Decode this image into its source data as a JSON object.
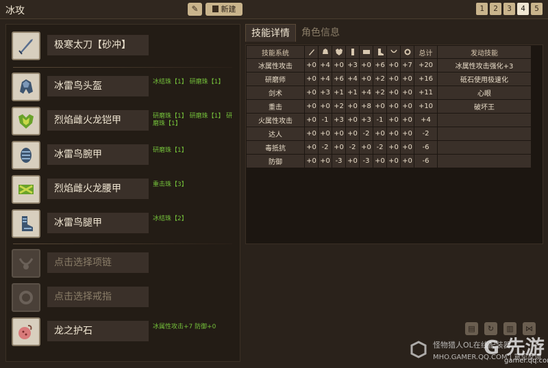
{
  "header": {
    "title": "冰攻",
    "edit_icon": "pencil-icon",
    "new_label": "新建",
    "pages": [
      "1",
      "2",
      "3",
      "4",
      "5"
    ],
    "active_page": "4"
  },
  "weapon": {
    "name": "极寒太刀【砂冲】",
    "icon": "sword-icon"
  },
  "armor": [
    {
      "name": "冰雷鸟头盔",
      "decorations": "冰结珠【1】  研磨珠【1】",
      "icon": "helmet-icon"
    },
    {
      "name": "烈焰雌火龙铠甲",
      "decorations": "研磨珠【1】  研磨珠【1】 研磨珠【1】",
      "icon": "chest-icon"
    },
    {
      "name": "冰雷鸟腕甲",
      "decorations": "研磨珠【1】",
      "icon": "arm-icon"
    },
    {
      "name": "烈焰雌火龙腰甲",
      "decorations": "重击珠【3】",
      "icon": "waist-icon"
    },
    {
      "name": "冰雷鸟腿甲",
      "decorations": "冰结珠【2】",
      "icon": "leg-icon"
    }
  ],
  "accessories": [
    {
      "name": "点击选择项链",
      "icon": "necklace-icon"
    },
    {
      "name": "点击选择戒指",
      "icon": "ring-icon"
    }
  ],
  "charm": {
    "name": "龙之护石",
    "decorations": "冰属性攻击+7  防御+0",
    "icon": "charm-icon"
  },
  "tabs": [
    "技能详情",
    "角色信息"
  ],
  "table": {
    "headers": {
      "skill": "技能系统",
      "total": "总计",
      "activated": "发动技能"
    },
    "column_icons": [
      "sword-icon",
      "helmet-icon",
      "chest-icon",
      "arm-icon",
      "waist-icon",
      "leg-icon",
      "necklace-icon",
      "ring-icon"
    ],
    "rows": [
      {
        "skill": "冰属性攻击",
        "vals": [
          "+0",
          "+4",
          "+0",
          "+3",
          "+0",
          "+6",
          "+0",
          "+7"
        ],
        "total": "+20",
        "activated": "冰属性攻击强化+3"
      },
      {
        "skill": "研磨师",
        "vals": [
          "+0",
          "+4",
          "+6",
          "+4",
          "+0",
          "+2",
          "+0",
          "+0"
        ],
        "total": "+16",
        "activated": "砥石使用极速化"
      },
      {
        "skill": "剑术",
        "vals": [
          "+0",
          "+3",
          "+1",
          "+1",
          "+4",
          "+2",
          "+0",
          "+0"
        ],
        "total": "+11",
        "activated": "心眼"
      },
      {
        "skill": "重击",
        "vals": [
          "+0",
          "+0",
          "+2",
          "+0",
          "+8",
          "+0",
          "+0",
          "+0"
        ],
        "total": "+10",
        "activated": "破坏王"
      },
      {
        "skill": "火属性攻击",
        "vals": [
          "+0",
          "-1",
          "+3",
          "+0",
          "+3",
          "-1",
          "+0",
          "+0"
        ],
        "total": "+4",
        "activated": ""
      },
      {
        "skill": "达人",
        "vals": [
          "+0",
          "+0",
          "+0",
          "+0",
          "-2",
          "+0",
          "+0",
          "+0"
        ],
        "total": "-2",
        "activated": ""
      },
      {
        "skill": "毒抵抗",
        "vals": [
          "+0",
          "-2",
          "+0",
          "-2",
          "+0",
          "-2",
          "+0",
          "+0"
        ],
        "total": "-6",
        "activated": ""
      },
      {
        "skill": "防御",
        "vals": [
          "+0",
          "+0",
          "-3",
          "+0",
          "-3",
          "+0",
          "+0",
          "+0"
        ],
        "total": "-6",
        "activated": ""
      }
    ]
  },
  "actions": [
    "save-icon",
    "refresh-icon",
    "trash-icon",
    "share-icon"
  ],
  "watermark": {
    "line1": "怪物猎人OL在线配装器",
    "line2": "MHO.GAMER.QQ.COM | 意见反馈",
    "brand": "G 先游",
    "url": "gamer.qq.com"
  },
  "colors": {
    "decoration_text": "#74c03a",
    "panel": "#3a3029",
    "accent_button": "#c9b48c"
  }
}
